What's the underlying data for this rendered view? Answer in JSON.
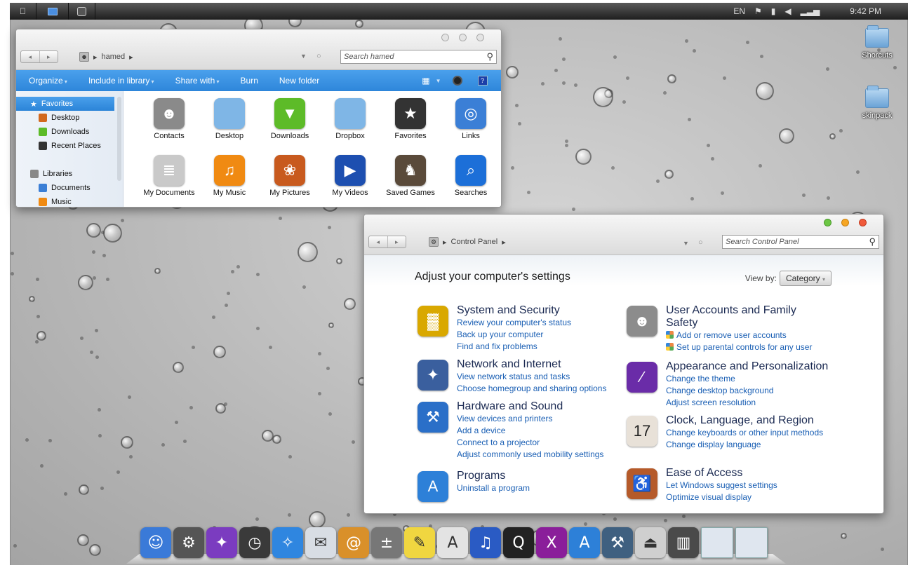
{
  "topbar": {
    "apps": [
      {
        "icon": "apple-icon"
      },
      {
        "icon": "computer-icon"
      },
      {
        "icon": "camera-icon"
      }
    ],
    "language": "EN",
    "clock": "9:42 PM"
  },
  "desktop_icons": [
    {
      "label": "Shorcuts"
    },
    {
      "label": "skinpack"
    }
  ],
  "explorer": {
    "breadcrumb": "hamed",
    "search_placeholder": "Search hamed",
    "toolbar": [
      "Organize",
      "Include in library",
      "Share with",
      "Burn",
      "New folder"
    ],
    "nav": {
      "favorites_label": "Favorites",
      "favorites": [
        "Desktop",
        "Downloads",
        "Recent Places"
      ],
      "libraries_label": "Libraries",
      "libraries": [
        "Documents",
        "Music"
      ]
    },
    "files": [
      {
        "label": "Contacts",
        "icon": "contacts-icon",
        "color": "#8a8a8a"
      },
      {
        "label": "Desktop",
        "icon": "folder-icon",
        "color": "#7fb6e6"
      },
      {
        "label": "Downloads",
        "icon": "downloads-icon",
        "color": "#5dbb28"
      },
      {
        "label": "Dropbox",
        "icon": "folder-icon",
        "color": "#7fb6e6"
      },
      {
        "label": "Favorites",
        "icon": "star-icon",
        "color": "#333333"
      },
      {
        "label": "Links",
        "icon": "links-icon",
        "color": "#3b7fd6"
      },
      {
        "label": "My Documents",
        "icon": "document-icon",
        "color": "#c9c9c9"
      },
      {
        "label": "My Music",
        "icon": "music-icon",
        "color": "#f08a12"
      },
      {
        "label": "My Pictures",
        "icon": "pictures-icon",
        "color": "#c85a1e"
      },
      {
        "label": "My Videos",
        "icon": "video-icon",
        "color": "#1d4fb0"
      },
      {
        "label": "Saved Games",
        "icon": "chess-icon",
        "color": "#5a4a3a"
      },
      {
        "label": "Searches",
        "icon": "search-icon",
        "color": "#1c6fd8"
      }
    ]
  },
  "control_panel": {
    "breadcrumb": "Control Panel",
    "search_placeholder": "Search Control Panel",
    "heading": "Adjust your computer's settings",
    "view_by_label": "View by:",
    "view_by_value": "Category",
    "categories": [
      {
        "title": "System and Security",
        "icon": "system-security-icon",
        "color": "#d9a800",
        "links": [
          "Review your computer's status",
          "Back up your computer",
          "Find and fix problems"
        ]
      },
      {
        "title": "Network and Internet",
        "icon": "network-icon",
        "color": "#3a5f9e",
        "links": [
          "View network status and tasks",
          "Choose homegroup and sharing options"
        ]
      },
      {
        "title": "Hardware and Sound",
        "icon": "hardware-icon",
        "color": "#2a6fc8",
        "links": [
          "View devices and printers",
          "Add a device",
          "Connect to a projector",
          "Adjust commonly used mobility settings"
        ]
      },
      {
        "title": "Programs",
        "icon": "programs-icon",
        "color": "#2d80d8",
        "links": [
          "Uninstall a program"
        ]
      },
      {
        "title": "User Accounts and Family Safety",
        "icon": "users-icon",
        "color": "#8c8c8c",
        "links": [
          "Add or remove user accounts",
          "Set up parental controls for any user"
        ]
      },
      {
        "title": "Appearance and Personalization",
        "icon": "appearance-icon",
        "color": "#6a2ca8",
        "links": [
          "Change the theme",
          "Change desktop background",
          "Adjust screen resolution"
        ]
      },
      {
        "title": "Clock, Language, and Region",
        "icon": "calendar-icon",
        "color": "#e8e1d8",
        "links": [
          "Change keyboards or other input methods",
          "Change display language"
        ]
      },
      {
        "title": "Ease of Access",
        "icon": "ease-access-icon",
        "color": "#b55a2a",
        "links": [
          "Let Windows suggest settings",
          "Optimize visual display"
        ]
      }
    ]
  },
  "calendar_day": "17",
  "dock": [
    {
      "icon": "finder-icon",
      "color": "#3a7ad8",
      "glyph": "☺"
    },
    {
      "icon": "system-preferences-icon",
      "color": "#555555",
      "glyph": "⚙"
    },
    {
      "icon": "photo-icon",
      "color": "#7b3cc0",
      "glyph": "✦"
    },
    {
      "icon": "dashboard-icon",
      "color": "#3a3a3a",
      "glyph": "◷"
    },
    {
      "icon": "safari-icon",
      "color": "#2f86e0",
      "glyph": "✧"
    },
    {
      "icon": "mail-icon",
      "color": "#d8dde4",
      "glyph": "✉"
    },
    {
      "icon": "contacts-book-icon",
      "color": "#d9902a",
      "glyph": "@"
    },
    {
      "icon": "calculator-icon",
      "color": "#777777",
      "glyph": "±"
    },
    {
      "icon": "stickies-icon",
      "color": "#f0d640",
      "glyph": "✎"
    },
    {
      "icon": "app-store-icon",
      "color": "#e3e3e3",
      "glyph": "A"
    },
    {
      "icon": "itunes-icon",
      "color": "#2a5bc4",
      "glyph": "♫"
    },
    {
      "icon": "quicktime-icon",
      "color": "#222222",
      "glyph": "Q"
    },
    {
      "icon": "x-app-icon",
      "color": "#8a1e9a",
      "glyph": "X"
    },
    {
      "icon": "app-store-blue-icon",
      "color": "#2d80d8",
      "glyph": "A"
    },
    {
      "icon": "utilities-icon",
      "color": "#3f6080",
      "glyph": "⚒"
    },
    {
      "icon": "eject-icon",
      "color": "#cfcfcf",
      "glyph": "⏏"
    },
    {
      "icon": "trash-icon",
      "color": "#4a4a4a",
      "glyph": "▥"
    },
    {
      "icon": "window-thumbnail-icon",
      "color": "#dfe6ef",
      "glyph": ""
    },
    {
      "icon": "window-thumbnail-icon",
      "color": "#dfe6ef",
      "glyph": ""
    }
  ]
}
